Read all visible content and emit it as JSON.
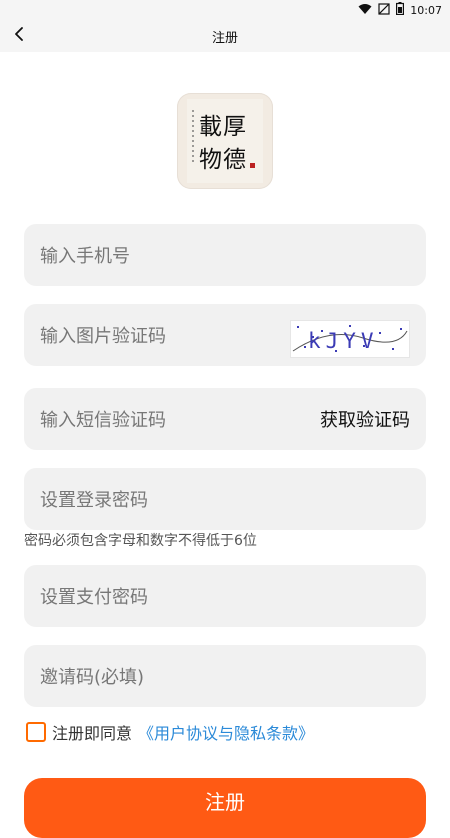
{
  "status_bar": {
    "time": "10:07",
    "icons": [
      "wifi-icon",
      "signal-off-icon",
      "battery-icon"
    ]
  },
  "header": {
    "title": "注册",
    "back_icon": "chevron-left-icon"
  },
  "logo": {
    "icon": "calligraphy-logo",
    "lines": [
      "厚",
      "德",
      "載",
      "物"
    ]
  },
  "form": {
    "phone_placeholder": "输入手机号",
    "image_code_placeholder": "输入图片验证码",
    "captcha_text": "kJYV",
    "sms_code_placeholder": "输入短信验证码",
    "get_code_label": "获取验证码",
    "login_password_placeholder": "设置登录密码",
    "password_hint": "密码必须包含字母和数字不得低于6位",
    "pay_password_placeholder": "设置支付密码",
    "invite_code_placeholder": "邀请码(必填)"
  },
  "agreement": {
    "checked": false,
    "prefix": "注册即同意",
    "link": "《用户协议与隐私条款》"
  },
  "submit": {
    "label": "注册"
  },
  "colors": {
    "accent": "#ff5a14",
    "link": "#2b8ad8",
    "checkbox": "#ff6a00",
    "field_bg": "#f1f1f1"
  }
}
